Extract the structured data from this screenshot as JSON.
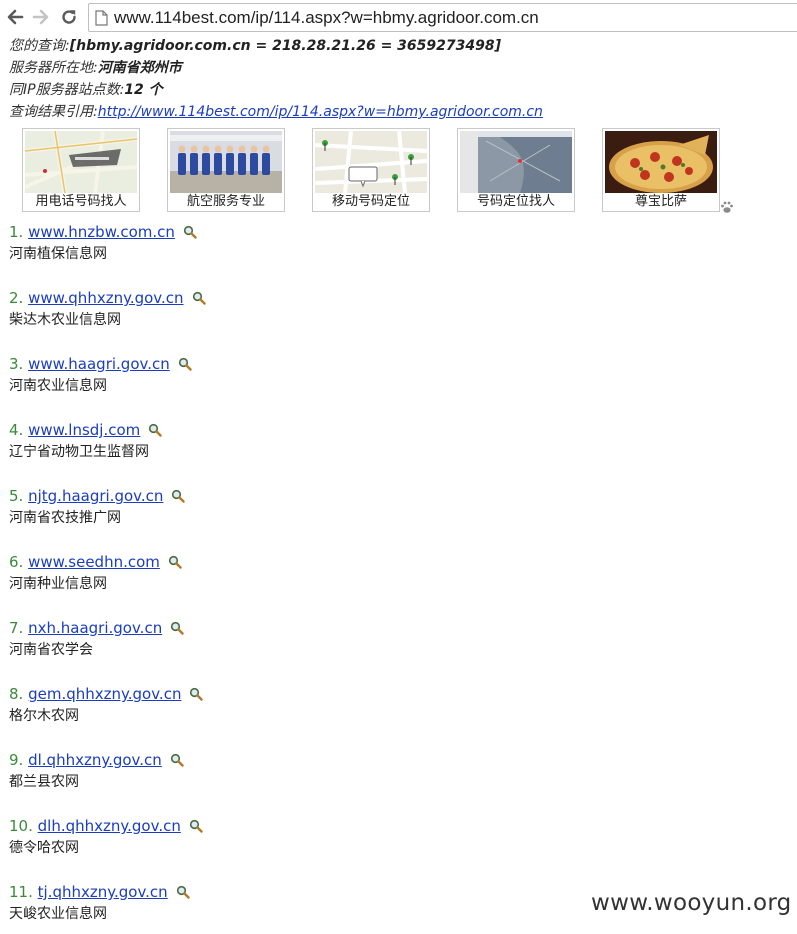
{
  "browser": {
    "url": "www.114best.com/ip/114.aspx?w=hbmy.agridoor.com.cn"
  },
  "query": {
    "label": "您的查询:",
    "value": "[hbmy.agridoor.com.cn = 218.28.21.26 = 3659273498]",
    "location_label": "服务器所在地:",
    "location_value": "河南省郑州市",
    "count_label": "同IP服务器站点数:",
    "count_value": "12 个",
    "cite_label": "查询结果引用:",
    "cite_link": "http://www.114best.com/ip/114.aspx?w=hbmy.agridoor.com.cn"
  },
  "thumbnails": [
    {
      "caption": "用电话号码找人",
      "image": "map"
    },
    {
      "caption": "航空服务专业",
      "image": "flight-attendants"
    },
    {
      "caption": "移动号码定位",
      "image": "map-pins"
    },
    {
      "caption": "号码定位找人",
      "image": "satellite-map"
    },
    {
      "caption": "尊宝比萨",
      "image": "pizza"
    }
  ],
  "results": [
    {
      "num": "1.",
      "domain": "www.hnzbw.com.cn",
      "desc": "河南植保信息网"
    },
    {
      "num": "2.",
      "domain": "www.qhhxzny.gov.cn",
      "desc": "柴达木农业信息网"
    },
    {
      "num": "3.",
      "domain": "www.haagri.gov.cn",
      "desc": "河南农业信息网"
    },
    {
      "num": "4.",
      "domain": "www.lnsdj.com",
      "desc": "辽宁省动物卫生监督网"
    },
    {
      "num": "5.",
      "domain": "njtg.haagri.gov.cn",
      "desc": "河南省农技推广网"
    },
    {
      "num": "6.",
      "domain": "www.seedhn.com",
      "desc": "河南种业信息网"
    },
    {
      "num": "7.",
      "domain": "nxh.haagri.gov.cn",
      "desc": "河南省农学会"
    },
    {
      "num": "8.",
      "domain": "gem.qhhxzny.gov.cn",
      "desc": "格尔木农网"
    },
    {
      "num": "9.",
      "domain": "dl.qhhxzny.gov.cn",
      "desc": "都兰县农网"
    },
    {
      "num": "10.",
      "domain": "dlh.qhhxzny.gov.cn",
      "desc": "德令哈农网"
    },
    {
      "num": "11.",
      "domain": "tj.qhhxzny.gov.cn",
      "desc": "天峻农业信息网"
    }
  ],
  "watermark": "www.wooyun.org",
  "icons": {
    "back": "back-arrow-icon",
    "forward": "forward-arrow-icon",
    "reload": "reload-icon",
    "page": "page-icon",
    "magnifier": "magnifier-icon",
    "paw": "paw-icon"
  },
  "colors": {
    "link": "#1a3dc1",
    "number": "#3a8a3a"
  }
}
